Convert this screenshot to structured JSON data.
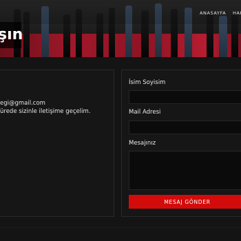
{
  "nav": {
    "items": [
      "ANASAYFA",
      "HAK"
    ]
  },
  "page": {
    "title": "şın"
  },
  "contact_info": {
    "email": "egi@gmail.com",
    "message": "ürede sizinle iletişime geçelim."
  },
  "form": {
    "name_label": "İsim Soyisim",
    "name_value": "",
    "email_label": "Mail Adresi",
    "email_value": "",
    "message_label": "Mesajınız",
    "message_value": "",
    "submit_label": "MESAJ GÖNDER"
  },
  "colors": {
    "accent": "#d40b0b",
    "background": "#141414",
    "panel": "#161616"
  }
}
